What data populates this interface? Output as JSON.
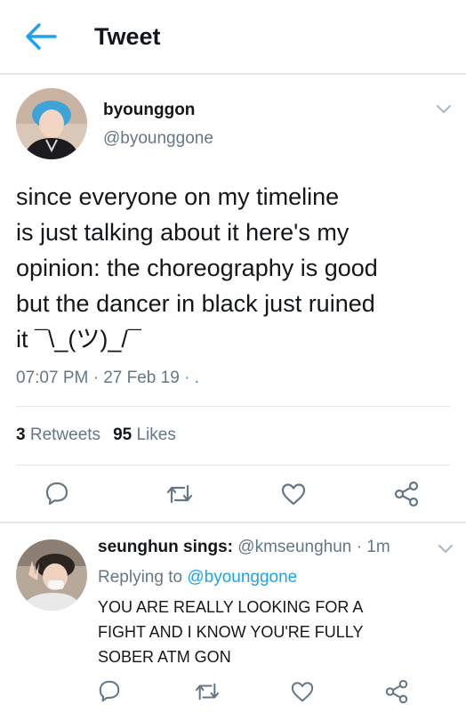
{
  "header": {
    "title": "Tweet",
    "back_icon": "arrow-left-icon",
    "accent": "#1da1f2"
  },
  "tweet": {
    "author_name": "byounggon",
    "author_handle": "@byounggone",
    "text": "since everyone on my timeline\nis just talking about it here's my\nopinion: the choreography is good\nbut the dancer in black just ruined\nit ¯\\_(ツ)_/¯",
    "time": "07:07 PM",
    "date": "27 Feb 19",
    "separator": "·",
    "trailing": "· .",
    "retweets_count": "3",
    "retweets_label": "Retweets",
    "likes_count": "95",
    "likes_label": "Likes",
    "actions": [
      "reply-icon",
      "retweet-icon",
      "like-icon",
      "share-icon"
    ]
  },
  "reply": {
    "author_name": "seunghun sings:",
    "author_handle": "@kmseunghun",
    "age": "1m",
    "separator": "·",
    "replying_prefix": "Replying to",
    "replying_to": "@byounggone",
    "text": "YOU ARE REALLY LOOKING FOR A\nFIGHT AND I KNOW YOU'RE FULLY\nSOBER ATM GON",
    "actions": [
      "reply-icon",
      "retweet-icon",
      "like-icon",
      "share-icon"
    ]
  }
}
